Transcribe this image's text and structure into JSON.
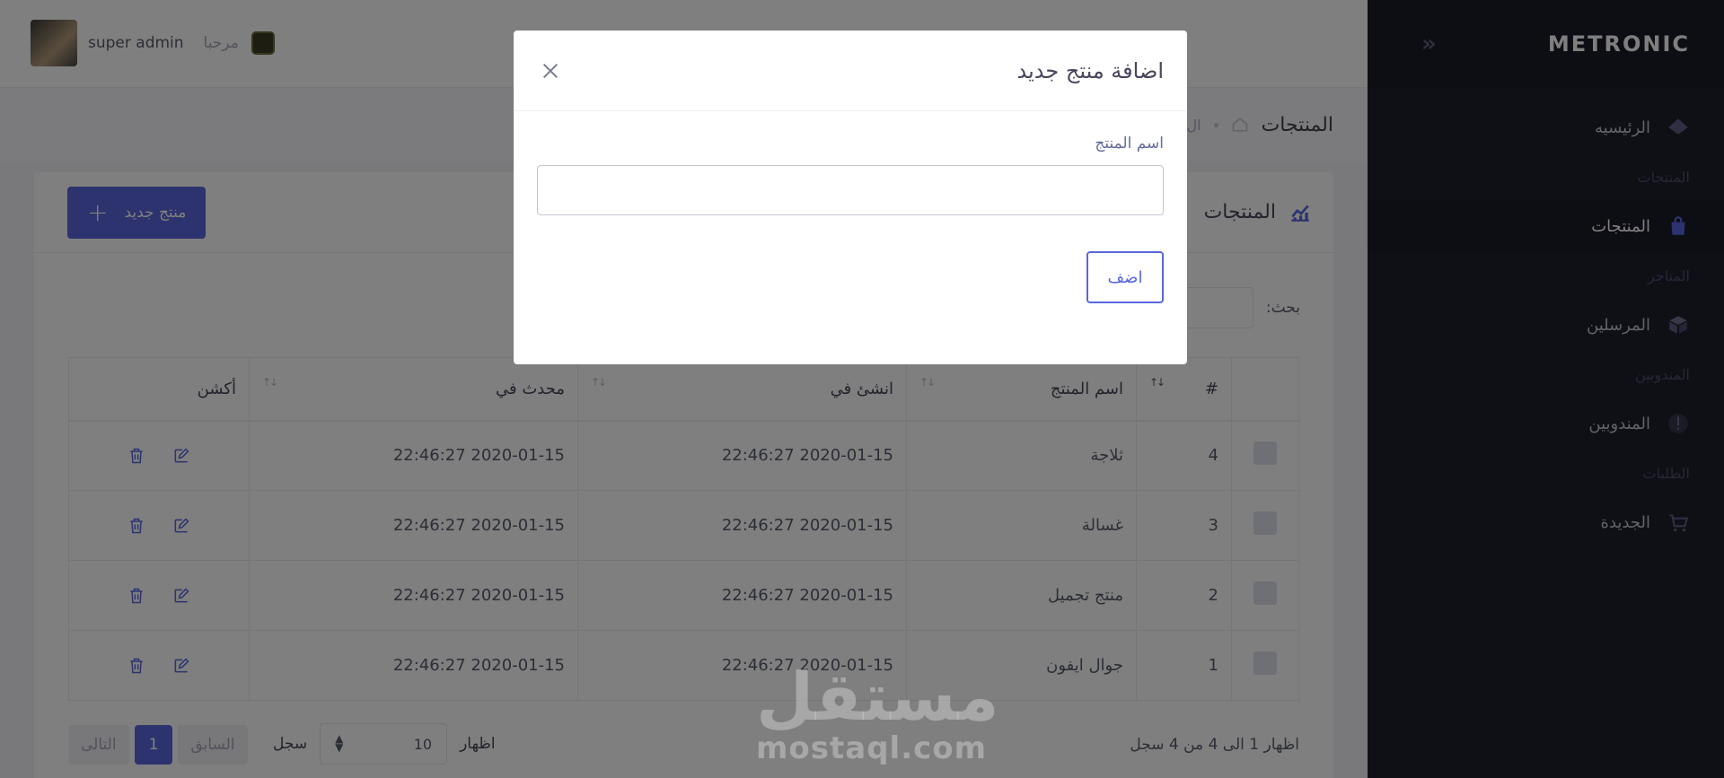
{
  "sidebar": {
    "logo": "METRONIC",
    "toggle_icon": "chevrons-left-icon",
    "items": [
      {
        "type": "item",
        "label": "الرئيسيه",
        "icon": "layers-icon",
        "active": false
      },
      {
        "type": "section",
        "label": "المنتجات"
      },
      {
        "type": "item",
        "label": "المنتجات",
        "icon": "shopping-bag-icon",
        "active": true
      },
      {
        "type": "section",
        "label": "المتاجر"
      },
      {
        "type": "item",
        "label": "المرسلين",
        "icon": "box-icon",
        "active": false
      },
      {
        "type": "section",
        "label": "المندوبين"
      },
      {
        "type": "item",
        "label": "المندوبين",
        "icon": "alert-icon",
        "active": false
      },
      {
        "type": "section",
        "label": "الطلبات"
      },
      {
        "type": "item",
        "label": "الجديدة",
        "icon": "cart-icon",
        "active": false
      }
    ]
  },
  "header": {
    "username": "super admin",
    "welcome": "مرحبا"
  },
  "subheader": {
    "title": "المنتجات",
    "breadcrumb": "ال"
  },
  "portlet": {
    "title": "المنتجات",
    "new_button": "منتج جديد",
    "search_label": "بحث:",
    "columns": [
      "#",
      "اسم المنتج",
      "انشئ في",
      "محدث في",
      "أكشن"
    ],
    "rows": [
      {
        "num": "4",
        "name": "ثلاجة",
        "created": "2020-01-15 22:46:27",
        "updated": "2020-01-15 22:46:27"
      },
      {
        "num": "3",
        "name": "غسالة",
        "created": "2020-01-15 22:46:27",
        "updated": "2020-01-15 22:46:27"
      },
      {
        "num": "2",
        "name": "منتج تجميل",
        "created": "2020-01-15 22:46:27",
        "updated": "2020-01-15 22:46:27"
      },
      {
        "num": "1",
        "name": "جوال ايفون",
        "created": "2020-01-15 22:46:27",
        "updated": "2020-01-15 22:46:27"
      }
    ],
    "info": "اظهار 1 الى 4 من 4 سجل",
    "length_show": "اظهار",
    "length_value": "10",
    "length_records": "سجل",
    "pager": {
      "prev": "السابق",
      "current": "1",
      "next": "التالى"
    }
  },
  "modal": {
    "title": "اضافة منتج جديد",
    "field_label": "اسم المنتج",
    "field_value": "",
    "add_button": "اضف"
  },
  "watermark": {
    "arabic": "مستقل",
    "latin": "mostaql.com"
  },
  "colors": {
    "primary": "#5867dd",
    "sidebar": "#1e1e2d",
    "overlay": "rgba(0,0,0,0.5)"
  }
}
